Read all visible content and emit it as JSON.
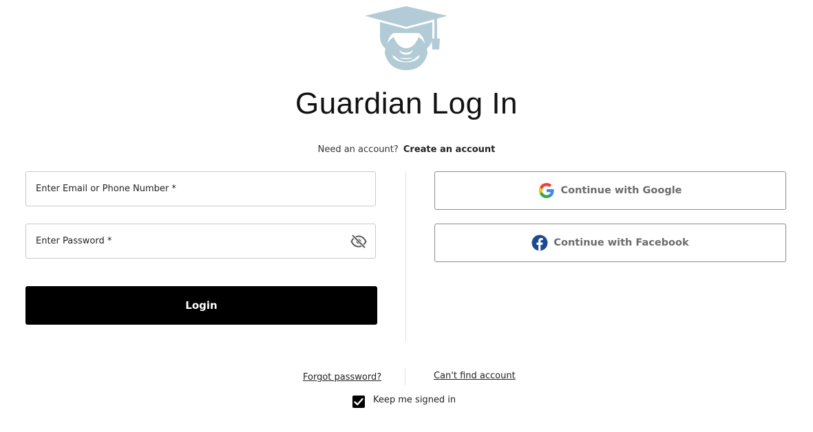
{
  "header": {
    "logo_icon": "graduate-cap-icon",
    "title": "Guardian Log In"
  },
  "signup": {
    "prompt": "Need an account?",
    "link": "Create an account"
  },
  "form": {
    "email_placeholder": "Enter Email or Phone Number *",
    "password_placeholder": "Enter Password *",
    "password_toggle_icon": "eye-off-icon",
    "login_label": "Login"
  },
  "social": {
    "google_label": "Continue with Google",
    "google_icon": "google-icon",
    "facebook_label": "Continue with Facebook",
    "facebook_icon": "facebook-icon"
  },
  "footer": {
    "forgot": "Forgot password?",
    "cant_find": "Can't find account",
    "keep_signed_in": "Keep me signed in",
    "keep_signed_in_checked": true
  },
  "colors": {
    "logo": "#b2cbd6",
    "button": "#000000",
    "facebook": "#1c4a8e"
  }
}
